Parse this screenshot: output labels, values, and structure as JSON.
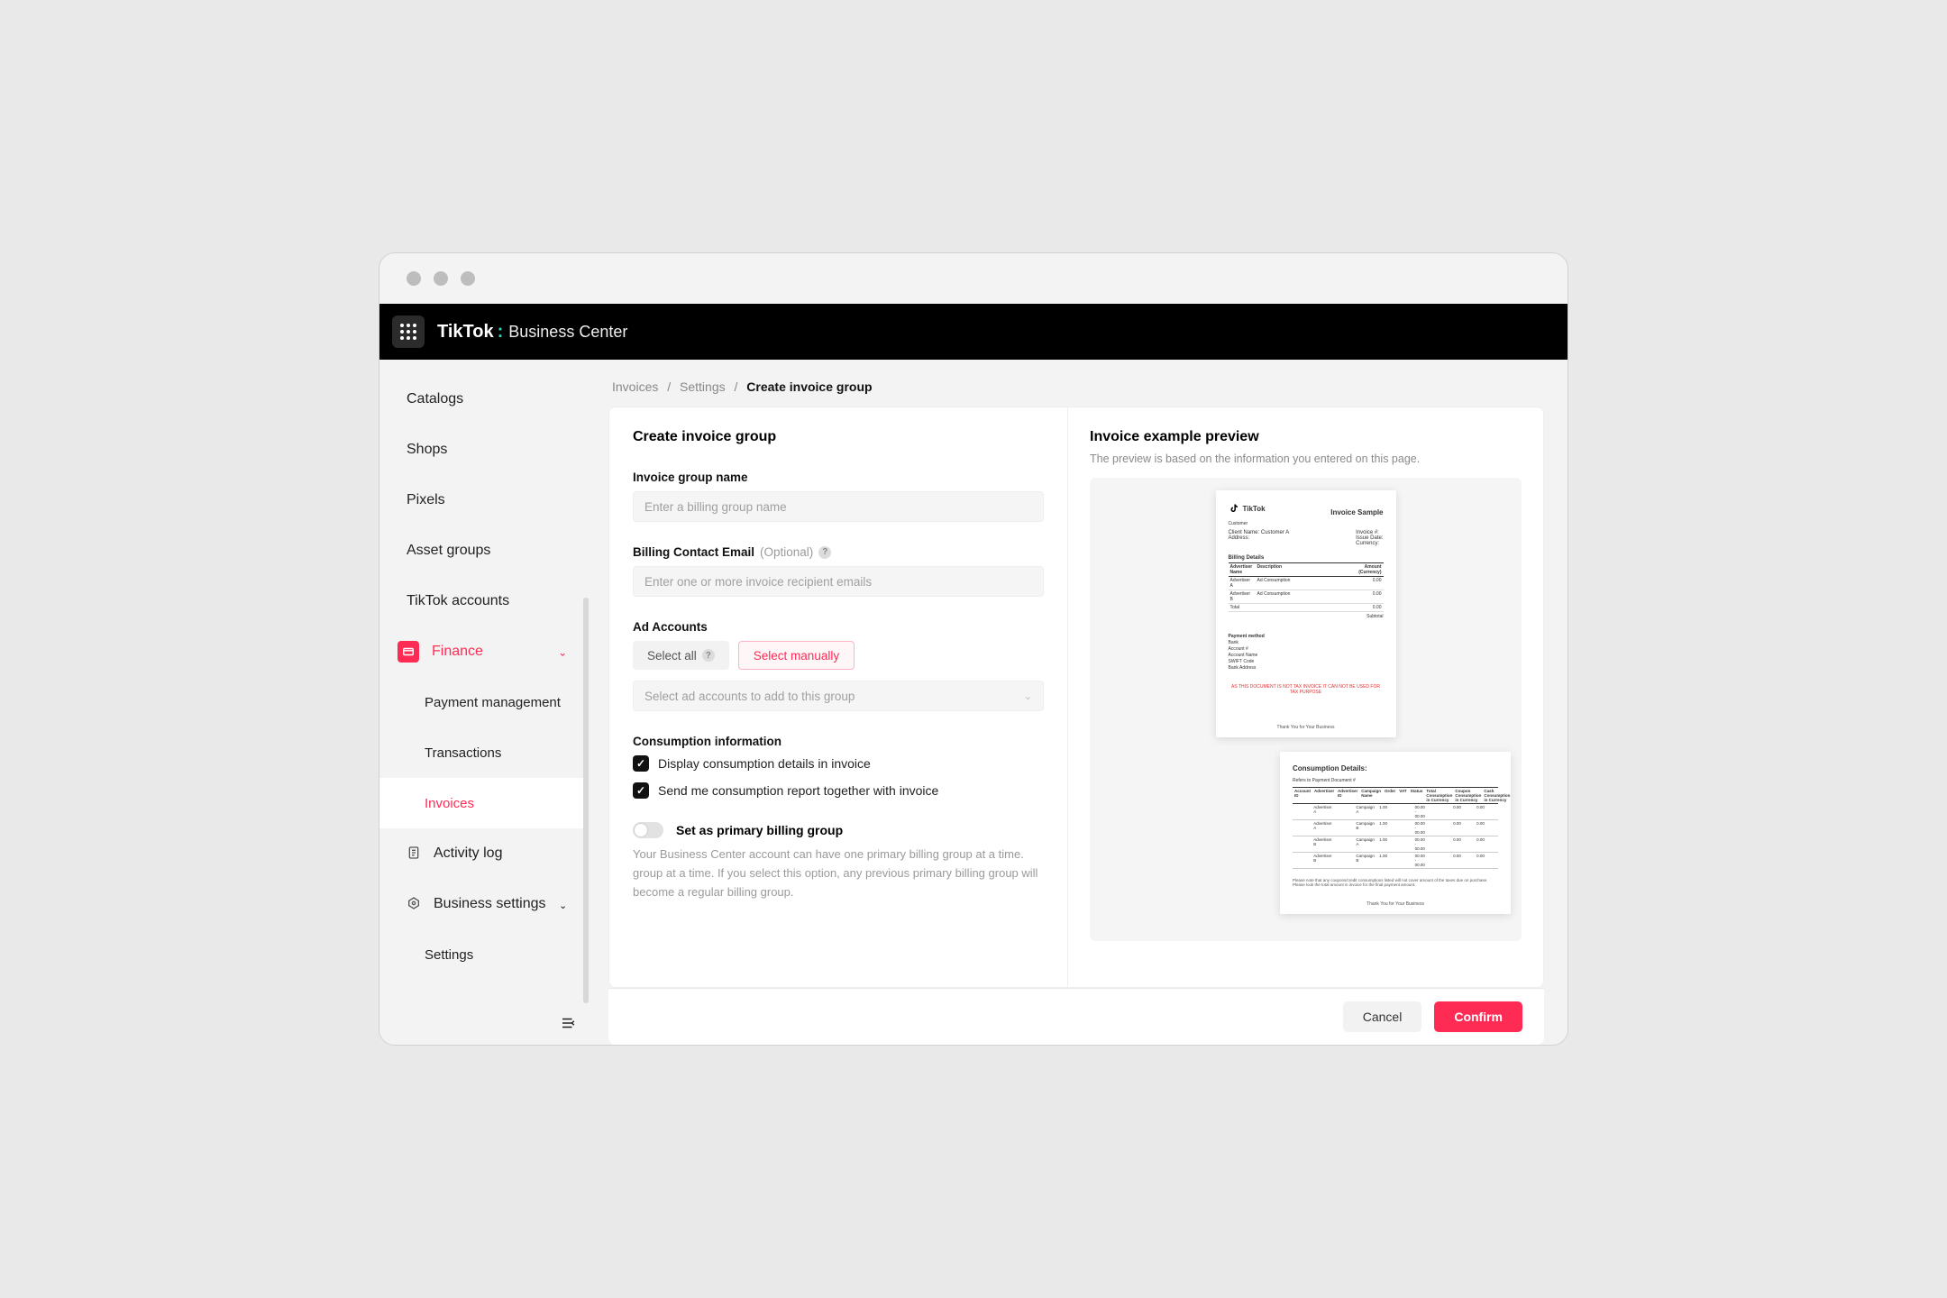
{
  "brand": {
    "name": "TikTok",
    "suffix": "Business Center"
  },
  "sidebar": {
    "items": [
      "Catalogs",
      "Shops",
      "Pixels",
      "Asset groups",
      "TikTok accounts"
    ],
    "finance": "Finance",
    "finance_children": [
      "Payment management",
      "Transactions",
      "Invoices"
    ],
    "activity_log": "Activity log",
    "business_settings": "Business settings",
    "settings": "Settings"
  },
  "breadcrumb": {
    "a": "Invoices",
    "b": "Settings",
    "c": "Create invoice group"
  },
  "form": {
    "title": "Create invoice group",
    "group_name_label": "Invoice group name",
    "group_name_placeholder": "Enter a billing group name",
    "contact_label": "Billing Contact Email",
    "contact_optional": "(Optional)",
    "contact_placeholder": "Enter one or more invoice recipient emails",
    "ad_accounts_label": "Ad Accounts",
    "seg_all": "Select all",
    "seg_manual": "Select manually",
    "ad_accounts_placeholder": "Select ad accounts to add to this group",
    "consumption_label": "Consumption information",
    "cb1": "Display consumption details in invoice",
    "cb2": "Send me consumption report together with invoice",
    "toggle_label": "Set as primary billing group",
    "helper": "Your Business Center account can have one primary billing group at a time. group at a time. If you select this option, any previous primary billing group will become a regular billing group."
  },
  "preview": {
    "title": "Invoice example preview",
    "subtitle": "The preview is based on the information you entered on this page.",
    "doc1": {
      "logo": "TikTok",
      "title": "Invoice Sample",
      "customer": "Customer",
      "client_name_label": "Client Name:",
      "client_name": "Customer A",
      "address_label": "Address:",
      "invoice_no_label": "Invoice #:",
      "issue_date_label": "Issue Date:",
      "currency_label": "Currency:",
      "section": "Billing Details",
      "h1": "Advertiser Name",
      "h2": "Description",
      "h3": "Amount (Currency)",
      "rows": [
        {
          "a": "Advertiser A",
          "b": "Ad Consumption",
          "c": "0.00"
        },
        {
          "a": "Advertiser B",
          "b": "Ad Consumption",
          "c": "0.00"
        },
        {
          "a": "Total",
          "b": "",
          "c": "0.00"
        }
      ],
      "subtotal": "Subtotal",
      "pay_title": "Payment method",
      "pay_lines": [
        "Bank",
        "Account #",
        "Account Name",
        "SWIFT Code",
        "Bank Address"
      ],
      "red": "AS THIS DOCUMENT IS NOT TAX INVOICE IT CAN NOT BE USED FOR TAX PURPOSE",
      "footer": "Thank You for Your Business"
    },
    "doc2": {
      "title": "Consumption Details:",
      "sub": "Refers to Payment Document #",
      "headers": [
        "Account ID",
        "Advertiser",
        "Advertiser ID",
        "Campaign Name",
        "Order",
        "VAT",
        "Status",
        "Total Consumption in Currency",
        "Coupon Consumption in Currency",
        "Cash Consumption in Currency"
      ],
      "rows": [
        [
          "",
          "Advertiser A",
          "",
          "Campaign A",
          "1.00",
          "",
          "00.00 - 00.00",
          "",
          "0.00",
          "0.00"
        ],
        [
          "",
          "Advertiser A",
          "",
          "Campaign B",
          "1.00",
          "",
          "00.00 - 00.00",
          "",
          "0.00",
          "0.00"
        ],
        [
          "",
          "Advertiser B",
          "",
          "Campaign A",
          "1.00",
          "",
          "00.00 - 00.00",
          "",
          "0.00",
          "0.00"
        ],
        [
          "",
          "Advertiser B",
          "",
          "Campaign B",
          "1.00",
          "",
          "00.00 - 00.00",
          "",
          "0.00",
          "0.00"
        ]
      ],
      "note": "Please note that any coupons/credit consumptions listed will not cover amount of the taxes due on purchase. Please look the total amount in invoice for the final payment amount.",
      "footer": "Thank You for Your Business"
    }
  },
  "actions": {
    "cancel": "Cancel",
    "confirm": "Confirm"
  }
}
